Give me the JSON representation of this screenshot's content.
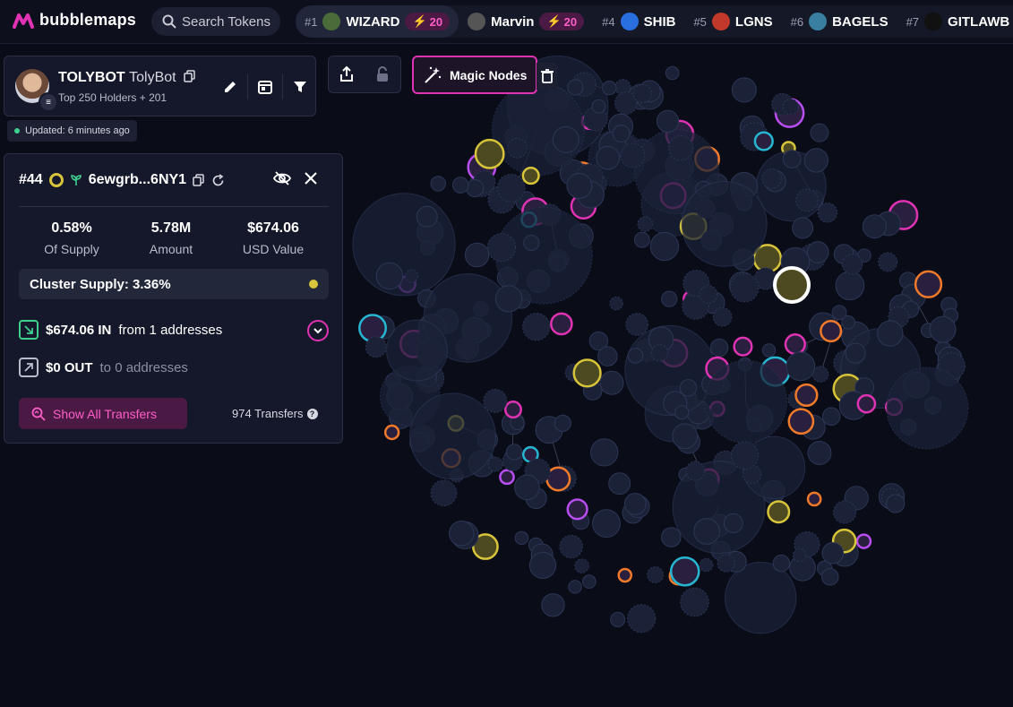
{
  "app": {
    "name": "bubblemaps",
    "brand_color": "#e033b3"
  },
  "search": {
    "label": "Search Tokens"
  },
  "trending": [
    {
      "rank": "#1",
      "name": "WIZARD",
      "boost": "20",
      "icon_color": "#4b6b3a",
      "active": true
    },
    {
      "rank": "",
      "name": "Marvin",
      "boost": "20",
      "icon_color": "#555",
      "active": false
    },
    {
      "rank": "#4",
      "name": "SHIB",
      "boost": "",
      "icon_color": "#2a6fe0",
      "active": false
    },
    {
      "rank": "#5",
      "name": "LGNS",
      "boost": "",
      "icon_color": "#c0392b",
      "active": false
    },
    {
      "rank": "#6",
      "name": "BAGELS",
      "boost": "",
      "icon_color": "#3a7fa0",
      "active": false
    },
    {
      "rank": "#7",
      "name": "GITLAWB",
      "boost": "",
      "icon_color": "#111",
      "active": false
    }
  ],
  "token": {
    "symbol": "TOLYBOT",
    "name": "TolyBot",
    "holders_text": "Top 250 Holders + 201",
    "updated": "Updated: 6 minutes ago"
  },
  "toolbar": {
    "magic_nodes": "Magic Nodes"
  },
  "holder": {
    "rank": "#44",
    "address": "6ewgrb...6NY1",
    "supply_pct": "0.58%",
    "supply_label": "Of Supply",
    "amount": "5.78M",
    "amount_label": "Amount",
    "usd_value": "$674.06",
    "usd_label": "USD Value",
    "cluster_supply": "Cluster Supply: 3.36%",
    "in_amount": "$674.06 IN",
    "in_from": "from 1 addresses",
    "out_amount": "$0 OUT",
    "out_to": "to 0 addresses",
    "show_all": "Show All Transfers",
    "transfers_count": "974 Transfers"
  },
  "colors": {
    "yellow": "#d7c43a",
    "magenta": "#e033b3",
    "purple": "#b84df0",
    "cyan": "#27b6d2",
    "orange": "#f07a2a",
    "node": "#1e2640"
  }
}
